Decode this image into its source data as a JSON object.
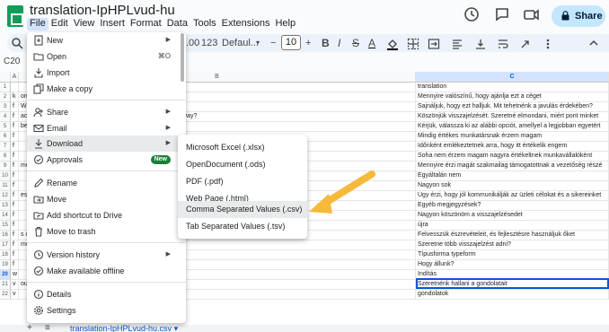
{
  "window": {
    "title": "translation-IpHPLvud-hu"
  },
  "menubar": [
    "File",
    "Edit",
    "View",
    "Insert",
    "Format",
    "Data",
    "Tools",
    "Extensions",
    "Help"
  ],
  "topbar": {
    "share_label": "Share"
  },
  "toolbar": {
    "zoom_frag": ".00",
    "number_fmt": "123",
    "font": "Defaul...",
    "font_size": "10",
    "minus": "−",
    "plus": "+"
  },
  "namebox": "C20",
  "columns": {
    "a": "A",
    "b": "B",
    "c": "C"
  },
  "rows": [
    {
      "n": "1",
      "a": "",
      "b": "",
      "c": "translation"
    },
    {
      "n": "2",
      "a": "k",
      "b": "ommend this company",
      "c": "Mennyire valószínű, hogy ajánlja ezt a céget"
    },
    {
      "n": "3",
      "a": "f",
      "b": "What could we do to improve?",
      "c": "Sajnáljuk, hogy ezt halljuk. Mit tehetnénk a javulás érdekében?"
    },
    {
      "n": "4",
      "a": "f",
      "b": "ack. Would you like to tell us why would you score us that way?",
      "c": "Köszönjük visszajelzését. Szeretné elmondani, miért pont minket"
    },
    {
      "n": "5",
      "a": "f",
      "b": "below that you most agree with",
      "c": "Kérjük, válassza ki az alábbi opciót, amellyel a legjobban egyetért"
    },
    {
      "n": "6",
      "a": "f",
      "b": "",
      "c": "Mindig értékes munkatársnak érzem magam"
    },
    {
      "n": "7",
      "a": "f",
      "b": "",
      "c": "Időnként emlékeztetnek arra, hogy itt értékelik engem"
    },
    {
      "n": "8",
      "a": "f",
      "b": "",
      "c": "Soha nem érzem magam nagyra értékeltnek munkavállalóként"
    },
    {
      "n": "9",
      "a": "f",
      "b": "ment team?",
      "c": "Mennyire érzi magát szakmailag támogatottnak a vezetőség részé"
    },
    {
      "n": "10",
      "a": "f",
      "b": "",
      "c": "Egyáltalán nem"
    },
    {
      "n": "11",
      "a": "f",
      "b": "",
      "c": "Nagyon sok"
    },
    {
      "n": "12",
      "a": "f",
      "b": "es well with the rest of the team?",
      "c": "Úgy érzi, hogy jól kommunikálják az üzleti célokat és a sikereinket"
    },
    {
      "n": "13",
      "a": "f",
      "b": "",
      "c": "Egyéb megjegyzések?"
    },
    {
      "n": "14",
      "a": "f",
      "b": "",
      "c": "Nagyon köszönöm a visszajelzésedet"
    },
    {
      "n": "15",
      "a": "f",
      "b": "",
      "c": "újra"
    },
    {
      "n": "16",
      "a": "f",
      "b": "s on board and use them to improve",
      "c": "Felvesszük észrevételeit, és fejlesztésre használjuk őket"
    },
    {
      "n": "17",
      "a": "f",
      "b": " more feedback?",
      "c": "Szeretne több visszajelzést adni?"
    },
    {
      "n": "18",
      "a": "f",
      "b": "",
      "c": "Típusforma typeform"
    },
    {
      "n": "19",
      "a": "f",
      "b": "",
      "c": "Hogy állunk?"
    },
    {
      "n": "20",
      "a": "w",
      "b": "",
      "c": "Indítás"
    },
    {
      "n": "21",
      "a": "v",
      "b": "oughts",
      "c": "Szeretnénk hallani a gondolatait"
    },
    {
      "n": "22",
      "a": "v",
      "b": "",
      "c": "gondolatok"
    }
  ],
  "file_menu": {
    "new": "New",
    "open": "Open",
    "open_shortcut": "⌘O",
    "import": "Import",
    "make_copy": "Make a copy",
    "share": "Share",
    "email": "Email",
    "download": "Download",
    "approvals": "Approvals",
    "approvals_badge": "New",
    "rename": "Rename",
    "move": "Move",
    "add_shortcut": "Add shortcut to Drive",
    "move_trash": "Move to trash",
    "version_history": "Version history",
    "make_offline": "Make available offline",
    "details": "Details",
    "settings": "Settings"
  },
  "download_menu": [
    "Microsoft Excel (.xlsx)",
    "OpenDocument (.ods)",
    "PDF (.pdf)",
    "Web Page (.html)",
    "Comma Separated Values (.csv)",
    "Tab Separated Values (.tsv)"
  ],
  "sheet_tab": "translation-IpHPLvud-hu.csv",
  "colors": {
    "accent": "#0b57d0",
    "share_bg": "#c2e7ff",
    "arrow": "#f6b93b",
    "badge": "#188038"
  }
}
